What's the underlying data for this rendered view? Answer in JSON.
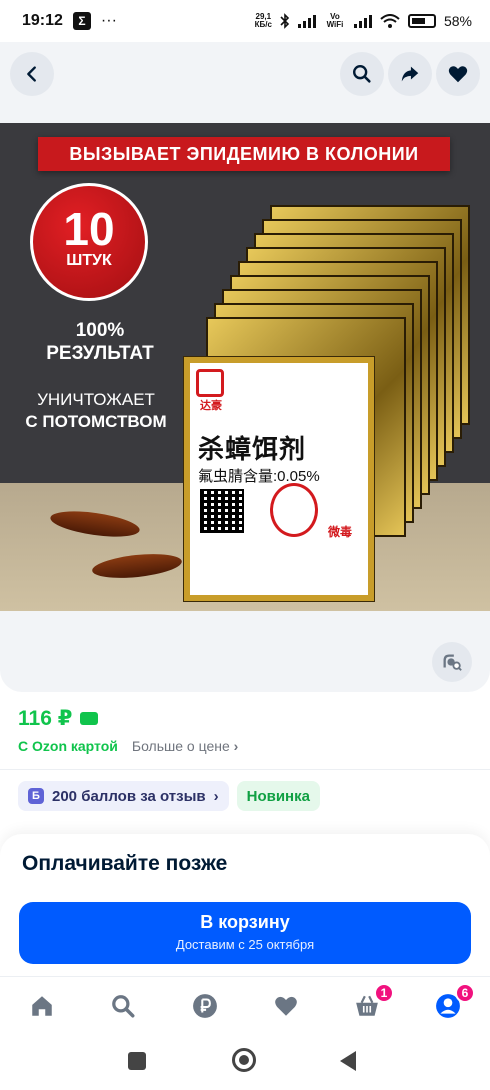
{
  "status_bar": {
    "time": "19:12",
    "app_icon": "Σ",
    "dots": "···",
    "net_speed_value": "29,1",
    "net_speed_unit": "КБ/с",
    "vowifi": "Vo WiFi",
    "battery": "58%"
  },
  "header": {
    "icons": [
      "back-icon",
      "search-icon",
      "share-icon",
      "heart-icon"
    ]
  },
  "product_image": {
    "banner": "ВЫЗЫВАЕТ ЭПИДЕМИЮ В КОЛОНИИ",
    "count_number": "10",
    "count_unit": "ШТУК",
    "result_line1": "100%",
    "result_line2": "РЕЗУЛЬТАТ",
    "kill_line1": "УНИЧТОЖАЕТ",
    "kill_line2": "С ПОТОМСТВОМ",
    "pack_title": "杀蟑饵剂",
    "pack_subtitle": "氟虫腈含量:0.05%",
    "pack_brand": "达豪",
    "pack_micro": "微毒"
  },
  "price": {
    "value": "116 ₽",
    "ozon_card": "С Ozon картой",
    "more_about_price": "Больше о цене",
    "chevron": "›"
  },
  "chips": {
    "points_icon": "Б",
    "points": "200 баллов за отзыв",
    "points_chevron": "›",
    "new": "Новинка"
  },
  "pay_later": {
    "title": "Оплачивайте позже"
  },
  "cart_button": {
    "label": "В корзину",
    "delivery": "Доставим с 25 октября"
  },
  "bottom_nav": {
    "items": [
      "home-icon",
      "search-icon",
      "ruble-icon",
      "heart-icon",
      "cart-icon",
      "profile-icon"
    ],
    "cart_badge": "1",
    "profile_badge": "6"
  },
  "colors": {
    "accent": "#005bff",
    "price_green": "#10c44c",
    "badge_pink": "#f1117e",
    "banner_red": "#c8191d"
  }
}
